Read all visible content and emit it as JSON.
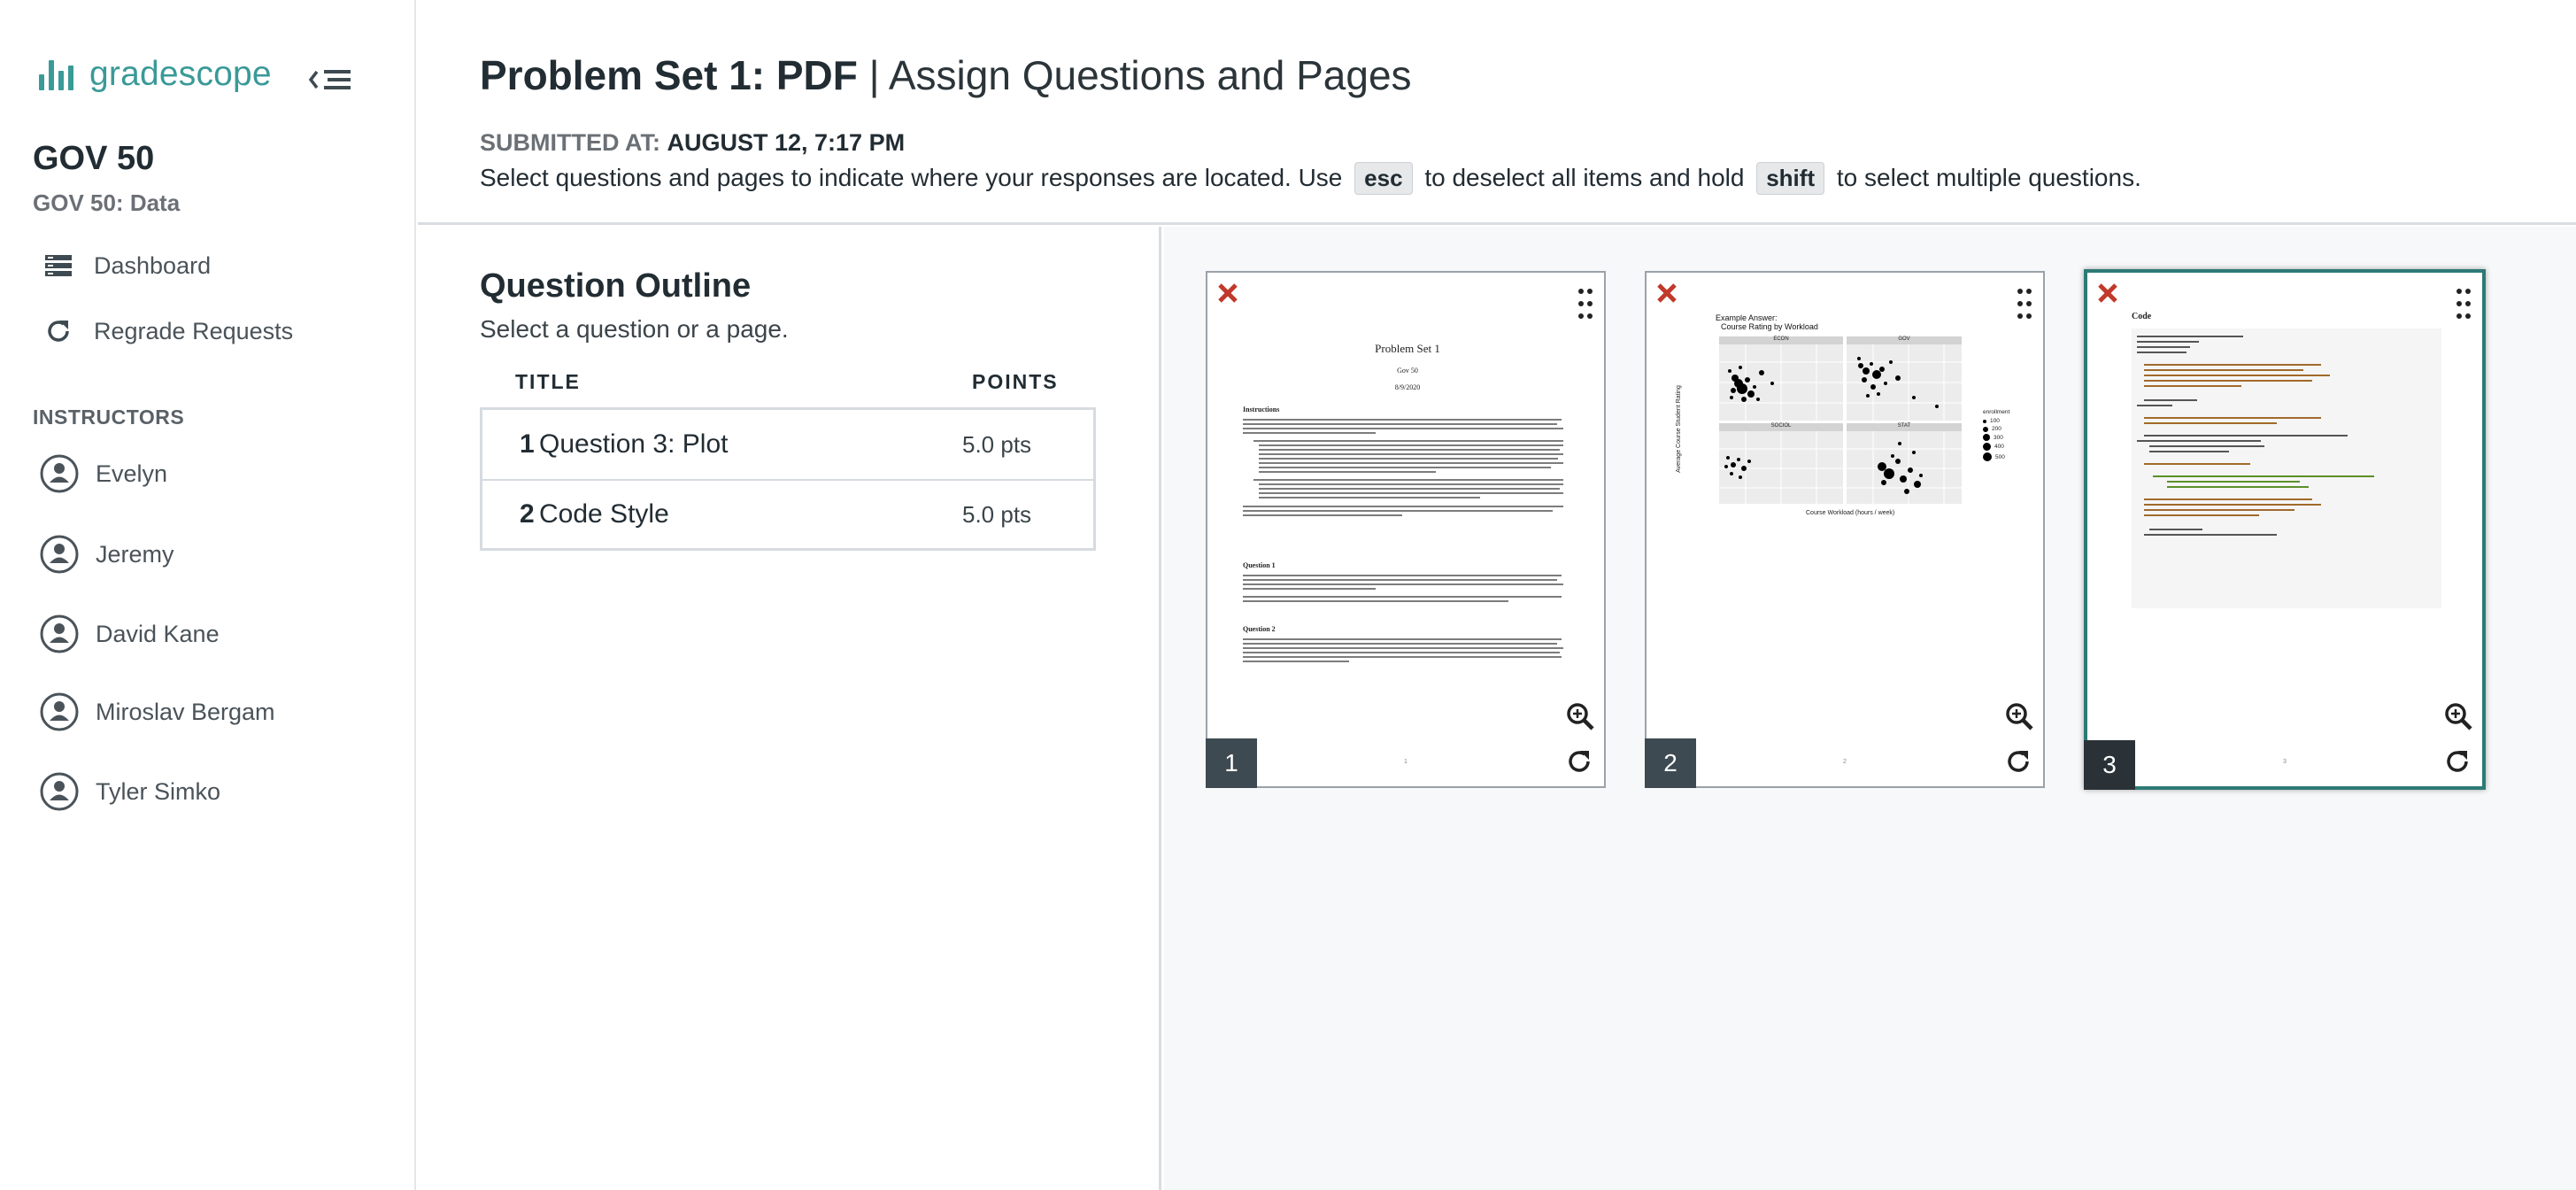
{
  "sidebar": {
    "brand": "gradescope",
    "course_title": "GOV 50",
    "course_subtitle": "GOV 50: Data",
    "nav": [
      {
        "label": "Dashboard",
        "icon": "dashboard-icon"
      },
      {
        "label": "Regrade Requests",
        "icon": "refresh-icon"
      }
    ],
    "instructors_label": "INSTRUCTORS",
    "instructors": [
      "Evelyn",
      "Jeremy",
      "David Kane",
      "Miroslav Bergam",
      "Tyler Simko"
    ]
  },
  "header": {
    "title_bold": "Problem Set 1: PDF",
    "title_sep": " | ",
    "title_rest": "Assign Questions and Pages",
    "submitted_label": "SUBMITTED AT:",
    "submitted_value": "AUGUST 12, 7:17 PM",
    "instr_a": "Select questions and pages to indicate where your responses are located. Use",
    "key_esc": "esc",
    "instr_b": "to deselect all items and hold",
    "key_shift": "shift",
    "instr_c": "to select multiple questions."
  },
  "outline": {
    "title": "Question Outline",
    "subtitle": "Select a question or a page.",
    "col_title": "TITLE",
    "col_points": "POINTS",
    "questions": [
      {
        "num": "1",
        "name": "Question 3: Plot",
        "points": "5.0 pts"
      },
      {
        "num": "2",
        "name": "Code Style",
        "points": "5.0 pts"
      }
    ]
  },
  "pages": [
    {
      "num": "1",
      "selected": false,
      "doc_title": "Problem Set 1",
      "doc_course": "Gov 50",
      "doc_date": "8/9/2020",
      "h_instructions": "Instructions",
      "h_q1": "Question 1",
      "h_q2": "Question 2",
      "footer": "1"
    },
    {
      "num": "2",
      "selected": false,
      "chart_caption": "Example Answer:",
      "chart_title": "Course Rating by Workload",
      "panels": [
        "ECON",
        "GOV",
        "SOCIOL",
        "STAT"
      ],
      "ylabel": "Average Course Student Rating",
      "xlabel": "Course Workload (hours / week)",
      "legend_title": "enrollment",
      "legend_items": [
        "100",
        "200",
        "300",
        "400",
        "500"
      ],
      "footer": "2"
    },
    {
      "num": "3",
      "selected": true,
      "heading": "Code",
      "footer": "3"
    }
  ],
  "colors": {
    "brand": "#3a9a98",
    "selected_border": "#2d7a75",
    "delete": "#c0392b"
  }
}
